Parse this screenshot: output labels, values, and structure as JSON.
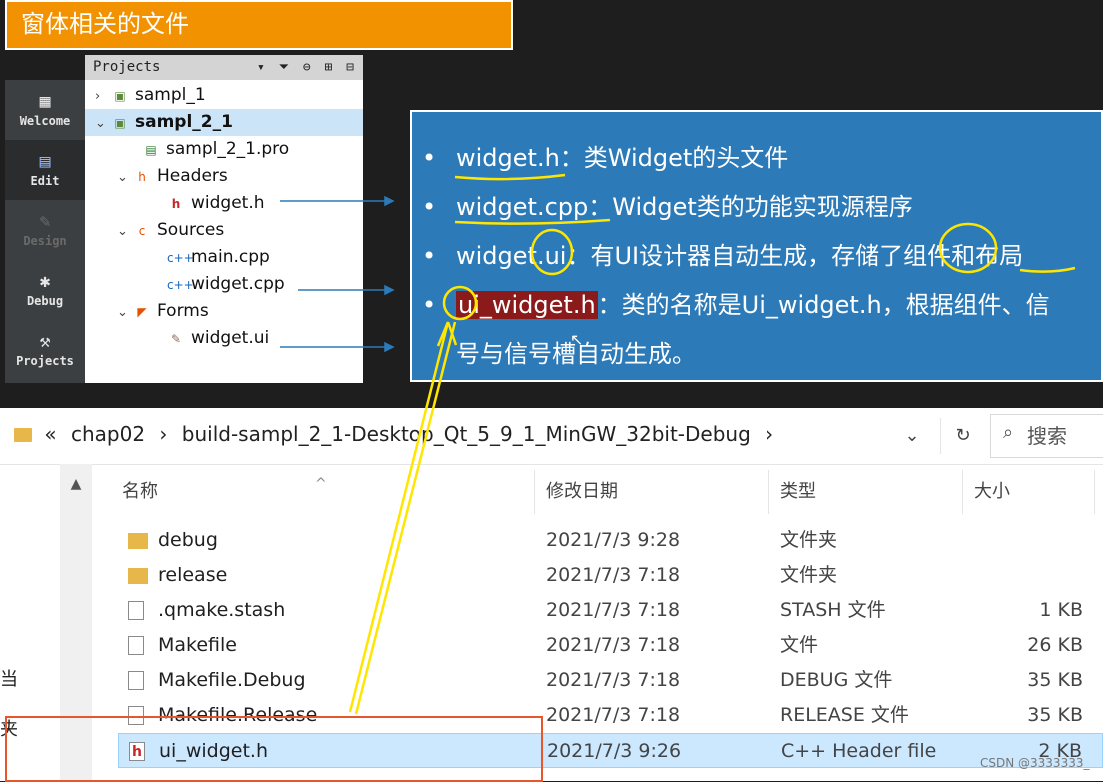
{
  "title_banner": "窗体相关的文件",
  "qt_modes": [
    {
      "label": "Welcome",
      "icon": "grid-icon",
      "state": "normal"
    },
    {
      "label": "Edit",
      "icon": "edit-icon",
      "state": "active"
    },
    {
      "label": "Design",
      "icon": "pencil-icon",
      "state": "disabled"
    },
    {
      "label": "Debug",
      "icon": "bug-icon",
      "state": "normal"
    },
    {
      "label": "Projects",
      "icon": "wrench-icon",
      "state": "normal"
    }
  ],
  "projects_panel": {
    "header": "Projects",
    "tree": [
      {
        "label": "sampl_1",
        "expand": "›",
        "icon": "project-icon"
      },
      {
        "label": "sampl_2_1",
        "expand": "⌄",
        "icon": "project-icon",
        "selected": true
      },
      {
        "label": "sampl_2_1.pro",
        "expand": "",
        "icon": "pro-file-icon"
      },
      {
        "label": "Headers",
        "expand": "⌄",
        "icon": "headers-folder-icon"
      },
      {
        "label": "widget.h",
        "expand": "",
        "icon": "header-file-icon"
      },
      {
        "label": "Sources",
        "expand": "⌄",
        "icon": "sources-folder-icon"
      },
      {
        "label": "main.cpp",
        "expand": "",
        "icon": "cpp-file-icon"
      },
      {
        "label": "widget.cpp",
        "expand": "",
        "icon": "cpp-file-icon"
      },
      {
        "label": "Forms",
        "expand": "⌄",
        "icon": "forms-folder-icon"
      },
      {
        "label": "widget.ui",
        "expand": "",
        "icon": "ui-file-icon"
      }
    ]
  },
  "explanations": [
    {
      "term": "widget.h",
      "sep": "：",
      "text": "类Widget的头文件"
    },
    {
      "term": "widget.cpp",
      "sep": "：",
      "text": "Widget类的功能实现源程序"
    },
    {
      "term": "widget.ui",
      "sep": "：",
      "text": "有UI设计器自动生成，存储了组件和布局"
    },
    {
      "term": "ui_widget.h",
      "sep": "：",
      "text": "类的名称是Ui_widget.h，根据组件、信"
    },
    {
      "term": "",
      "sep": "",
      "text": "号与信号槽自动生成。"
    }
  ],
  "explorer": {
    "breadcrumb_prefix": "«",
    "breadcrumb": [
      "chap02",
      "build-sampl_2_1-Desktop_Qt_5_9_1_MinGW_32bit-Debug"
    ],
    "search_placeholder": "搜索",
    "columns": {
      "name": "名称",
      "date": "修改日期",
      "type": "类型",
      "size": "大小"
    },
    "files": [
      {
        "name": "debug",
        "date": "2021/7/3 9:28",
        "type": "文件夹",
        "size": "",
        "kind": "folder"
      },
      {
        "name": "release",
        "date": "2021/7/3 7:18",
        "type": "文件夹",
        "size": "",
        "kind": "folder"
      },
      {
        "name": ".qmake.stash",
        "date": "2021/7/3 7:18",
        "type": "STASH 文件",
        "size": "1 KB",
        "kind": "file"
      },
      {
        "name": "Makefile",
        "date": "2021/7/3 7:18",
        "type": "文件",
        "size": "26 KB",
        "kind": "file"
      },
      {
        "name": "Makefile.Debug",
        "date": "2021/7/3 7:18",
        "type": "DEBUG 文件",
        "size": "35 KB",
        "kind": "file"
      },
      {
        "name": "Makefile.Release",
        "date": "2021/7/3 7:18",
        "type": "RELEASE 文件",
        "size": "35 KB",
        "kind": "file"
      },
      {
        "name": "ui_widget.h",
        "date": "2021/7/3 9:26",
        "type": "C++ Header file",
        "size": "2 KB",
        "kind": "header",
        "selected": true
      }
    ],
    "left_chars": [
      "当",
      "夹"
    ]
  },
  "watermark": "CSDN @3333333_",
  "colors": {
    "banner": "#f39200",
    "panel": "#2c7ab8",
    "highlight": "#8b1a1a",
    "annotation": "#ffe600",
    "selection": "#cce8ff"
  }
}
